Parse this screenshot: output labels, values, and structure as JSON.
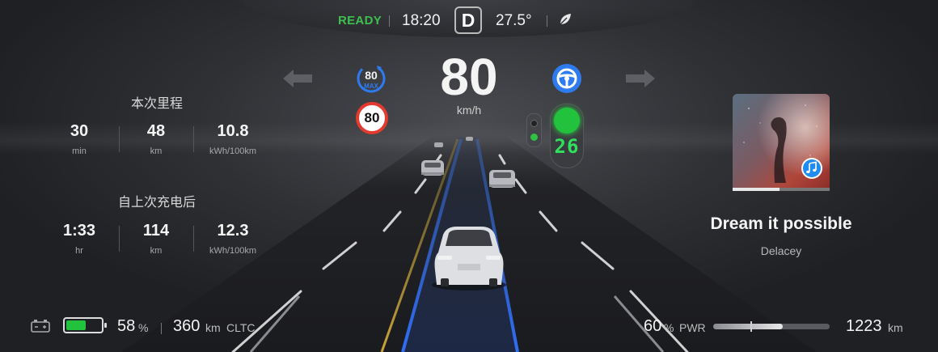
{
  "status": {
    "ready": "READY",
    "time": "18:20",
    "gear": "D",
    "temperature": "27.5°",
    "eco_icon": "leaf-icon",
    "ready_color": "#3fbf4f"
  },
  "speed": {
    "value": "80",
    "unit": "km/h"
  },
  "limits": {
    "max_value": "80",
    "max_label": "MAX",
    "sign_value": "80"
  },
  "traffic_light": {
    "countdown": "26",
    "color": "#22c23d"
  },
  "trip": {
    "title": "本次里程",
    "stats": [
      {
        "value": "30",
        "unit": "min"
      },
      {
        "value": "48",
        "unit": "km"
      },
      {
        "value": "10.8",
        "unit": "kWh/100km"
      }
    ]
  },
  "since_charge": {
    "title": "自上次充电后",
    "stats": [
      {
        "value": "1:33",
        "unit": "hr"
      },
      {
        "value": "114",
        "unit": "km"
      },
      {
        "value": "12.3",
        "unit": "kWh/100km"
      }
    ]
  },
  "media": {
    "song": "Dream it possible",
    "artist": "Delacey",
    "progress": 0.48,
    "app_icon": "music-note-icon"
  },
  "battery": {
    "percent_value": "58",
    "percent_unit": "%",
    "level": 0.58,
    "range_value": "360",
    "range_unit": "km",
    "range_standard": "CLTC"
  },
  "power": {
    "percent_value": "60",
    "percent_unit": "%",
    "label": "PWR",
    "level": 0.6,
    "odometer_value": "1223",
    "odometer_unit": "km"
  }
}
